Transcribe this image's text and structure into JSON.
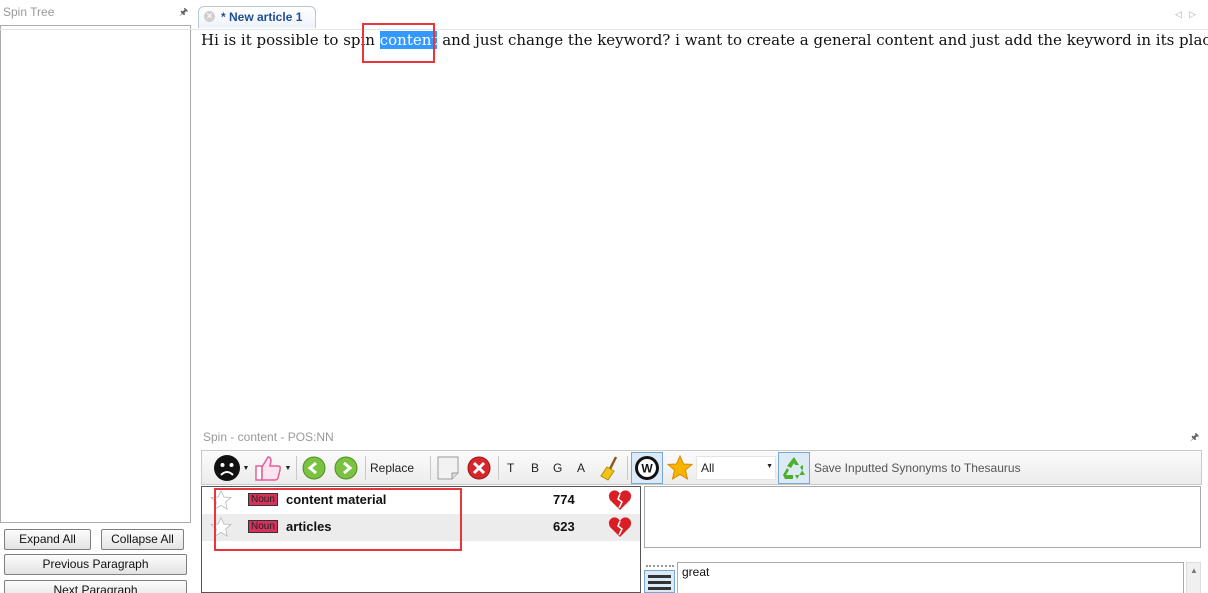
{
  "left_panel": {
    "title": "Spin Tree",
    "expand_all": "Expand All",
    "collapse_all": "Collapse All",
    "previous_paragraph": "Previous Paragraph",
    "next_paragraph": "Next Paragraph"
  },
  "editor": {
    "tab_label": "* New article 1",
    "text_before": "Hi is it possible to spin ",
    "selected_word": "content",
    "text_after": " and just change the keyword? i want to create a general content and just add the keyword in its place"
  },
  "spin_panel": {
    "title": "Spin - content - POS:NN",
    "toolbar": {
      "replace_label": "Replace",
      "t_label": "T",
      "b_label": "B",
      "g_label": "G",
      "a_label": "A",
      "filter_value": "All",
      "save_label": "Save Inputted Synonyms to Thesaurus"
    },
    "synonyms": [
      {
        "pos": "Noun",
        "text": "content material",
        "count": "774"
      },
      {
        "pos": "Noun",
        "text": "articles",
        "count": "623"
      }
    ],
    "input_value": "great"
  },
  "colors": {
    "highlight": "#3399ff",
    "annotation_red": "#e8363a",
    "tab_text": "#1f4e96",
    "noun_badge": "#d6315d"
  },
  "icons": [
    "pin-icon",
    "close-icon",
    "arrow-left-icon",
    "arrow-right-icon",
    "sad-face-icon",
    "thumbs-up-icon",
    "green-back-icon",
    "green-forward-icon",
    "note-icon",
    "red-x-icon",
    "broom-icon",
    "w-badge-icon",
    "star-icon",
    "recycle-icon",
    "heart-broken-icon",
    "menu-lines-icon"
  ]
}
